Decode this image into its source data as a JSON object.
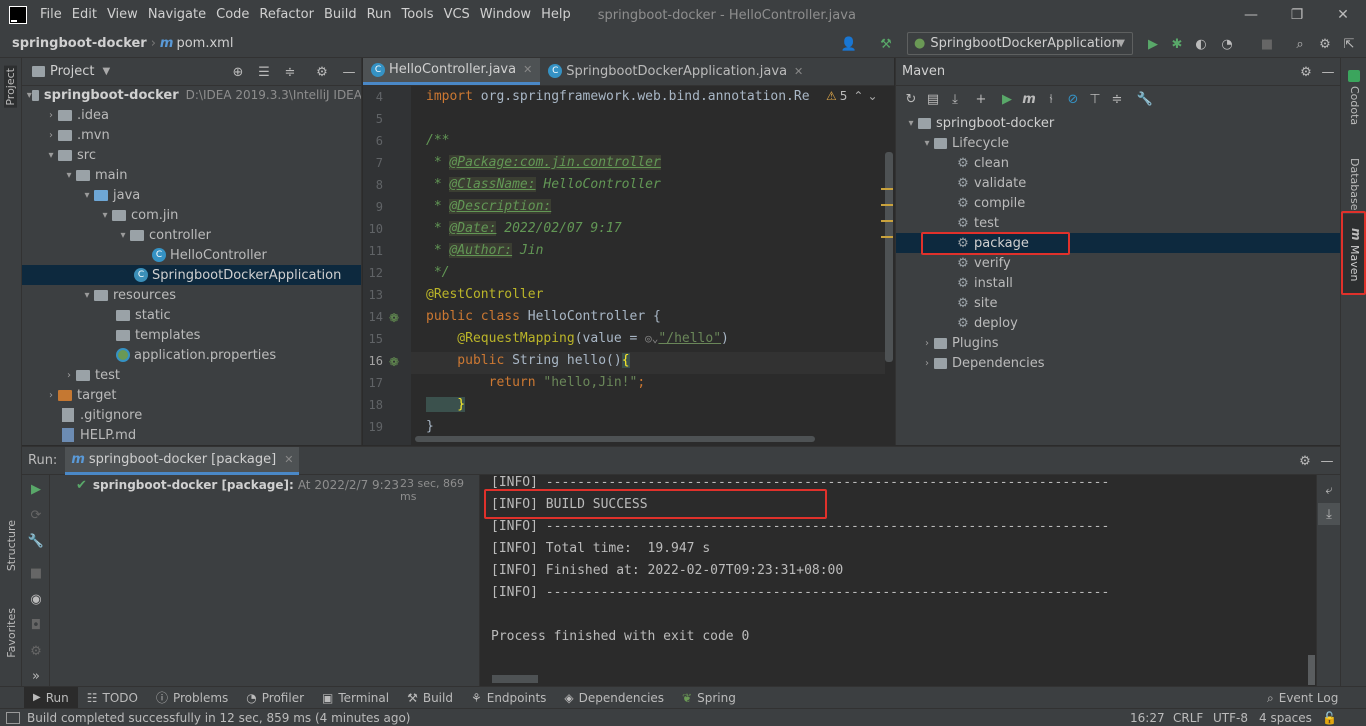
{
  "window": {
    "title": "springboot-docker - HelloController.java",
    "menu": [
      "File",
      "Edit",
      "View",
      "Navigate",
      "Code",
      "Refactor",
      "Build",
      "Run",
      "Tools",
      "VCS",
      "Window",
      "Help"
    ]
  },
  "nav": {
    "project": "springboot-docker",
    "file": "pom.xml",
    "run_config": "SpringbootDockerApplication"
  },
  "project_panel": {
    "title": "Project",
    "root": "springboot-docker",
    "root_path": "D:\\IDEA 2019.3.3\\IntelliJ IDEA",
    "items": {
      "idea": ".idea",
      "mvn": ".mvn",
      "src": "src",
      "main": "main",
      "java": "java",
      "comjin": "com.jin",
      "controller": "controller",
      "hello": "HelloController",
      "app": "SpringbootDockerApplication",
      "resources": "resources",
      "static": "static",
      "templates": "templates",
      "props": "application.properties",
      "test": "test",
      "target": "target",
      "gitignore": ".gitignore",
      "help": "HELP.md"
    }
  },
  "editor": {
    "tabs": [
      "HelloController.java",
      "SpringbootDockerApplication.java"
    ],
    "inspection_count": "5",
    "line_numbers": [
      "4",
      "5",
      "6",
      "7",
      "8",
      "9",
      "10",
      "11",
      "12",
      "13",
      "14",
      "15",
      "16",
      "17",
      "18",
      "19"
    ],
    "code": {
      "l4_kw": "import",
      "l4_rest": " org.springframework.web.bind.annotation.Re",
      "l6": "/**",
      "l7_star": " * ",
      "l7_tag": "@Package:com.jin.controller",
      "l8_star": " * ",
      "l8_tag": "@ClassName:",
      "l8_val": " HelloController",
      "l9_star": " * ",
      "l9_tag": "@Description:",
      "l10_star": " * ",
      "l10_tag": "@Date:",
      "l10_val": " 2022/02/07 9:17",
      "l11_star": " * ",
      "l11_tag": "@Author:",
      "l11_val": " Jin",
      "l12": " */",
      "l13": "@RestController",
      "l14_kw": "public class",
      "l14_rest": " HelloController {",
      "l15_ann": "    @RequestMapping",
      "l15_mid": "(value = ",
      "l15_str": "\"/hello\"",
      "l15_end": ")",
      "l16_kw": "    public",
      "l16_rest": " String hello()",
      "l16_brace": "{",
      "l17_kw": "        return",
      "l17_str": " \"hello,Jin!\"",
      "l17_end": ";",
      "l18": "    }",
      "l19": "}"
    }
  },
  "maven": {
    "title": "Maven",
    "root": "springboot-docker",
    "lifecycle": "Lifecycle",
    "goals": [
      "clean",
      "validate",
      "compile",
      "test",
      "package",
      "verify",
      "install",
      "site",
      "deploy"
    ],
    "plugins": "Plugins",
    "dependencies": "Dependencies"
  },
  "right_stripe": {
    "codota": "Codota",
    "database": "Database",
    "maven": "Maven"
  },
  "left_stripe": {
    "project": "Project",
    "structure": "Structure",
    "favorites": "Favorites"
  },
  "run": {
    "label": "Run:",
    "tab": "springboot-docker [package]",
    "tree_item": "springboot-docker [package]:",
    "tree_time": "At 2022/2/7 9:23",
    "duration": "23 sec, 869 ms",
    "console": [
      "[INFO] ------------------------------------------------------------------------",
      "[INFO] BUILD SUCCESS",
      "[INFO] ------------------------------------------------------------------------",
      "[INFO] Total time:  19.947 s",
      "[INFO] Finished at: 2022-02-07T09:23:31+08:00",
      "[INFO] ------------------------------------------------------------------------",
      "",
      "Process finished with exit code 0"
    ]
  },
  "bottom_tabs": [
    "Run",
    "TODO",
    "Problems",
    "Profiler",
    "Terminal",
    "Build",
    "Endpoints",
    "Dependencies",
    "Spring"
  ],
  "event_log": "Event Log",
  "status": {
    "message": "Build completed successfully in 12 sec, 859 ms (4 minutes ago)",
    "position": "16:27",
    "line_sep": "CRLF",
    "encoding": "UTF-8",
    "indent": "4 spaces"
  },
  "colors": {
    "highlight": "#e0312b",
    "accent": "#4a88c7"
  }
}
